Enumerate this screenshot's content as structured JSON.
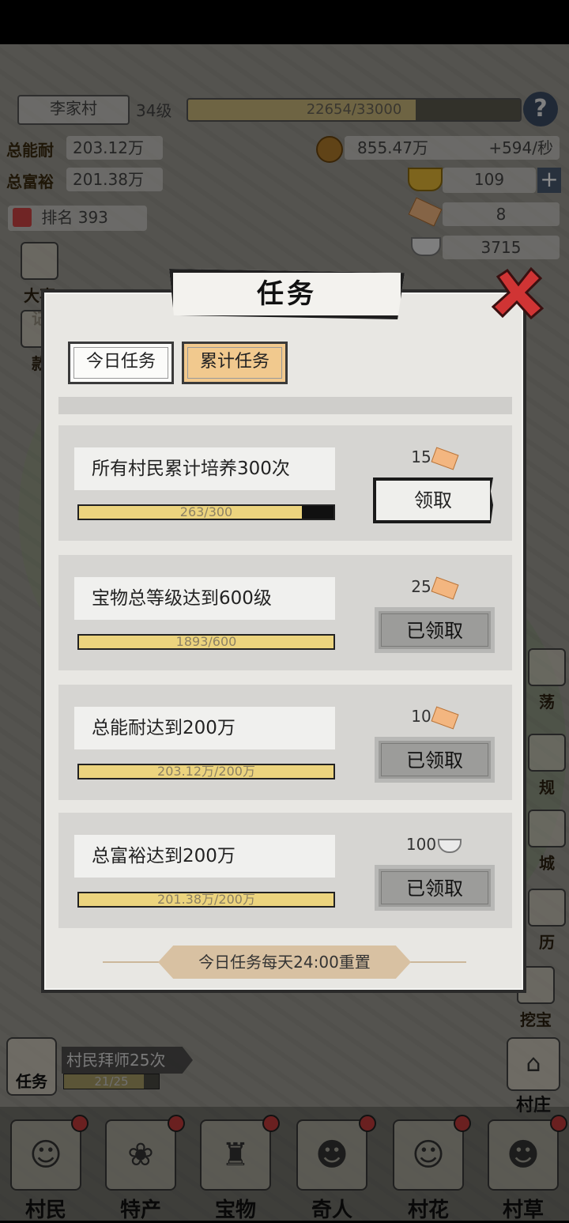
{
  "hud": {
    "village_name": "李家村",
    "level": "34级",
    "xp_text": "22654/33000",
    "xp_fraction": 0.686,
    "total_ability_label": "总能耐",
    "total_ability": "203.12万",
    "total_wealth_label": "总富裕",
    "total_wealth": "201.38万",
    "rank_label": "排名",
    "rank": "393",
    "coins": "855.47万",
    "coin_rate": "+594/秒",
    "gold": "109",
    "tickets": "8",
    "silver": "3715",
    "help": "?"
  },
  "side": {
    "left": [
      {
        "label": "大事记"
      },
      {
        "label": "款"
      }
    ],
    "right": [
      {
        "label": "荡"
      },
      {
        "label": "规"
      },
      {
        "label": "城"
      },
      {
        "label": "历"
      },
      {
        "label": "挖宝"
      }
    ]
  },
  "task_widget": {
    "label": "任务",
    "banner": "村民拜师25次",
    "progress_text": "21/25",
    "progress_fraction": 0.84
  },
  "village_btn": {
    "label": "村庄"
  },
  "nav": [
    {
      "label": "村民"
    },
    {
      "label": "特产"
    },
    {
      "label": "宝物"
    },
    {
      "label": "奇人"
    },
    {
      "label": "村花"
    },
    {
      "label": "村草"
    }
  ],
  "modal": {
    "title": "任务",
    "tabs": {
      "daily": "今日任务",
      "cumulative": "累计任务"
    },
    "tasks": [
      {
        "label": "所有村民累计培养300次",
        "progress_text": "263/300",
        "progress_fraction": 0.877,
        "reward": "15",
        "reward_type": "ticket",
        "button": "领取",
        "state": "ready"
      },
      {
        "label": "宝物总等级达到600级",
        "progress_text": "1893/600",
        "progress_fraction": 1.0,
        "reward": "25",
        "reward_type": "ticket",
        "button": "已领取",
        "state": "done"
      },
      {
        "label": "总能耐达到200万",
        "progress_text": "203.12万/200万",
        "progress_fraction": 1.0,
        "reward": "10",
        "reward_type": "ticket",
        "button": "已领取",
        "state": "done"
      },
      {
        "label": "总富裕达到200万",
        "progress_text": "201.38万/200万",
        "progress_fraction": 1.0,
        "reward": "100",
        "reward_type": "silver",
        "button": "已领取",
        "state": "done"
      }
    ],
    "footer_note": "今日任务每天24:00重置"
  },
  "colors": {
    "accent_tab": "#f1c98e",
    "progress_fill": "#ecd47e",
    "close_red": "#d03434"
  }
}
